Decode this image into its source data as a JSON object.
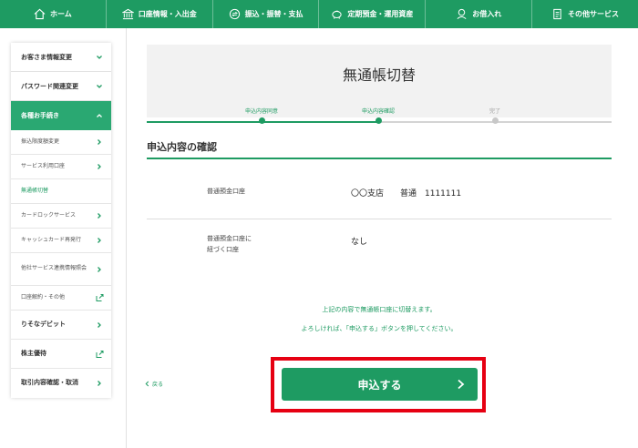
{
  "nav": {
    "items": [
      {
        "label": "ホーム",
        "icon": "home-icon"
      },
      {
        "label": "口座情報・入出金",
        "icon": "bank-icon"
      },
      {
        "label": "振込・振替・支払",
        "icon": "transfer-icon"
      },
      {
        "label": "定期預金・運用資産",
        "icon": "piggybank-icon"
      },
      {
        "label": "お借入れ",
        "icon": "loan-icon"
      },
      {
        "label": "その他サービス",
        "icon": "document-icon"
      }
    ]
  },
  "sidebar": {
    "items": [
      {
        "label": "お客さま情報変更"
      },
      {
        "label": "パスワード関連変更"
      },
      {
        "label": "各種お手続き"
      }
    ],
    "subitems": [
      {
        "label": "振込限度額変更"
      },
      {
        "label": "サービス利用口座"
      },
      {
        "label": "無通帳切替"
      },
      {
        "label": "カードロックサービス"
      },
      {
        "label": "キャッシュカード再発行"
      },
      {
        "label": "他社サービス連携情報照会"
      },
      {
        "label": "口座解約・その他"
      }
    ],
    "bottom": [
      {
        "label": "りそなデビット"
      },
      {
        "label": "株主優待"
      },
      {
        "label": "取引内容確認・取消"
      }
    ]
  },
  "steps": {
    "title": "無通帳切替",
    "labels": [
      "申込内容同意",
      "申込内容確認",
      "完了"
    ]
  },
  "section": {
    "title": "申込内容の確認"
  },
  "rows": [
    {
      "label": "普通預金口座",
      "value": "〇〇支店　　普通　1111111"
    },
    {
      "label_line1": "普通預金口座に",
      "label_line2": "紐づく口座",
      "value": "なし"
    }
  ],
  "note": {
    "line1": "上記の内容で無通帳口座に切替えます。",
    "line2": "よろしければ、「申込する」ボタンを押してください。"
  },
  "back_label": "戻る",
  "submit_label": "申込する",
  "colors": {
    "brand": "#1e9b62",
    "highlight": "#e60012"
  }
}
